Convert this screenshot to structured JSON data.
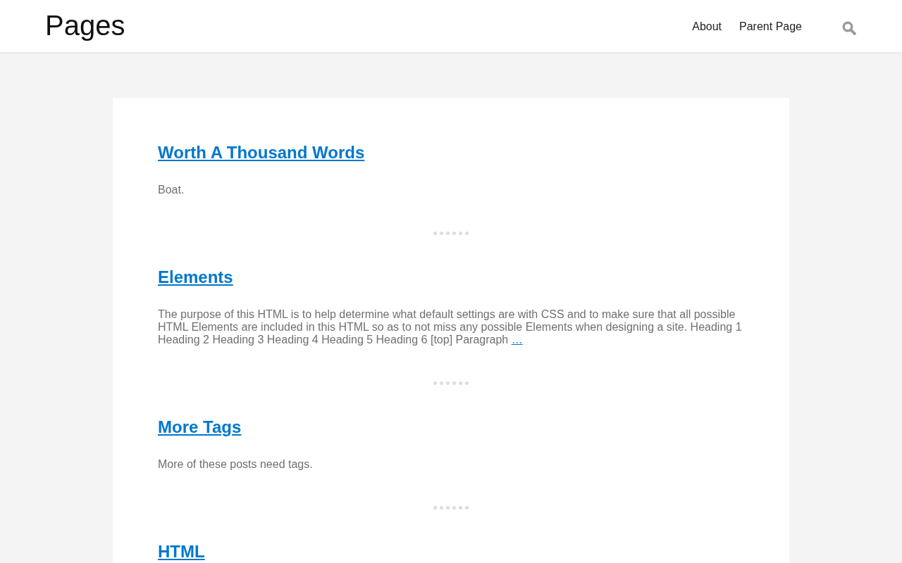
{
  "site_title": "Pages",
  "nav": {
    "items": [
      {
        "label": "About"
      },
      {
        "label": "Parent Page"
      }
    ]
  },
  "posts": [
    {
      "title": "Worth A Thousand Words",
      "excerpt": "Boat."
    },
    {
      "title": "Elements",
      "excerpt": "The purpose of this HTML is to help determine what default settings are with CSS and to make sure that all possible HTML Elements are included in this HTML so as to not miss any possible Elements when designing a site. Heading 1 Heading 2 Heading 3 Heading 4 Heading 5 Heading 6 [top] Paragraph",
      "more_link": "…"
    },
    {
      "title": "More Tags",
      "excerpt": "More of these posts need tags."
    },
    {
      "title": "HTML"
    }
  ]
}
